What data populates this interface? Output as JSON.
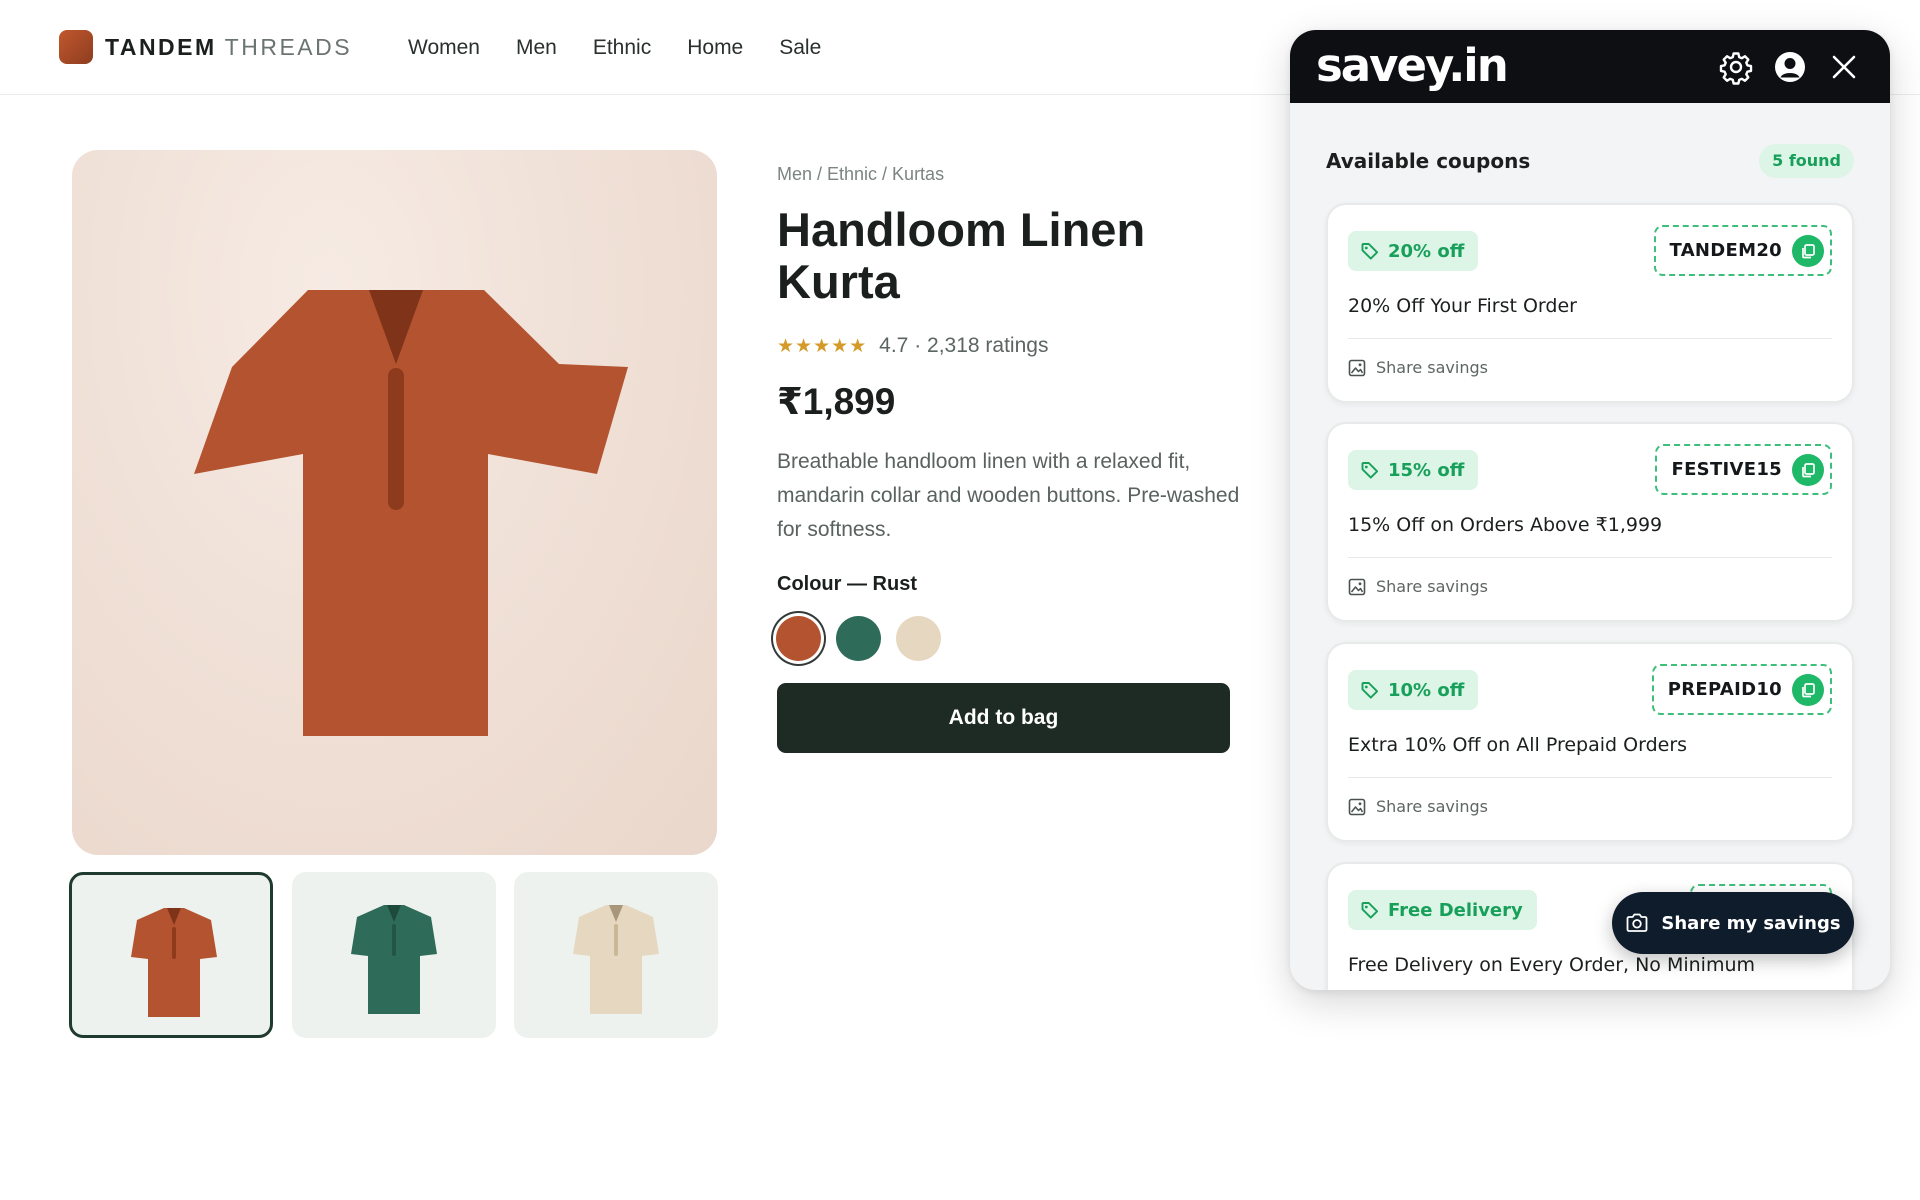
{
  "store": {
    "brand_primary": "TANDEM",
    "brand_secondary": "THREADS",
    "nav": [
      "Women",
      "Men",
      "Ethnic",
      "Home",
      "Sale"
    ]
  },
  "product": {
    "breadcrumb": "Men / Ethnic / Kurtas",
    "title": "Handloom Linen Kurta",
    "stars": "★★★★★",
    "rating_text": "4.7 · 2,318 ratings",
    "price": "₹1,899",
    "description": "Breathable handloom linen with a relaxed fit, mandarin collar and wooden buttons. Pre-washed for softness.",
    "colour_label": "Colour — Rust",
    "swatches": [
      {
        "name": "Rust",
        "color": "#b4532f",
        "selected": true
      },
      {
        "name": "Green",
        "color": "#2e6b58",
        "selected": false
      },
      {
        "name": "Cream",
        "color": "#e6d8c0",
        "selected": false
      }
    ],
    "add_to_bag": "Add to bag",
    "thumbnails": [
      {
        "color": "#b4532f",
        "collar": "#7f3419",
        "selected": true
      },
      {
        "color": "#2e6b58",
        "collar": "#1e4a3c",
        "selected": false
      },
      {
        "color": "#e6d8c0",
        "collar": "#a8967a",
        "selected": false
      }
    ]
  },
  "extension": {
    "logo": "savey.in",
    "panel_title": "Available coupons",
    "found_badge": "5 found",
    "coupons": [
      {
        "discount": "20% off",
        "code": "TANDEM20",
        "offer": "20% Off Your First Order",
        "share": "Share savings"
      },
      {
        "discount": "15% off",
        "code": "FESTIVE15",
        "offer": "15% Off on Orders Above ₹1,999",
        "share": "Share savings"
      },
      {
        "discount": "10% off",
        "code": "PREPAID10",
        "offer": "Extra 10% Off on All Prepaid Orders",
        "share": "Share savings"
      },
      {
        "discount": "Free Delivery",
        "code": "",
        "offer": "Free Delivery on Every Order, No Minimum",
        "share": ""
      }
    ],
    "share_button": "Share my savings",
    "accent": "#1fb868"
  }
}
